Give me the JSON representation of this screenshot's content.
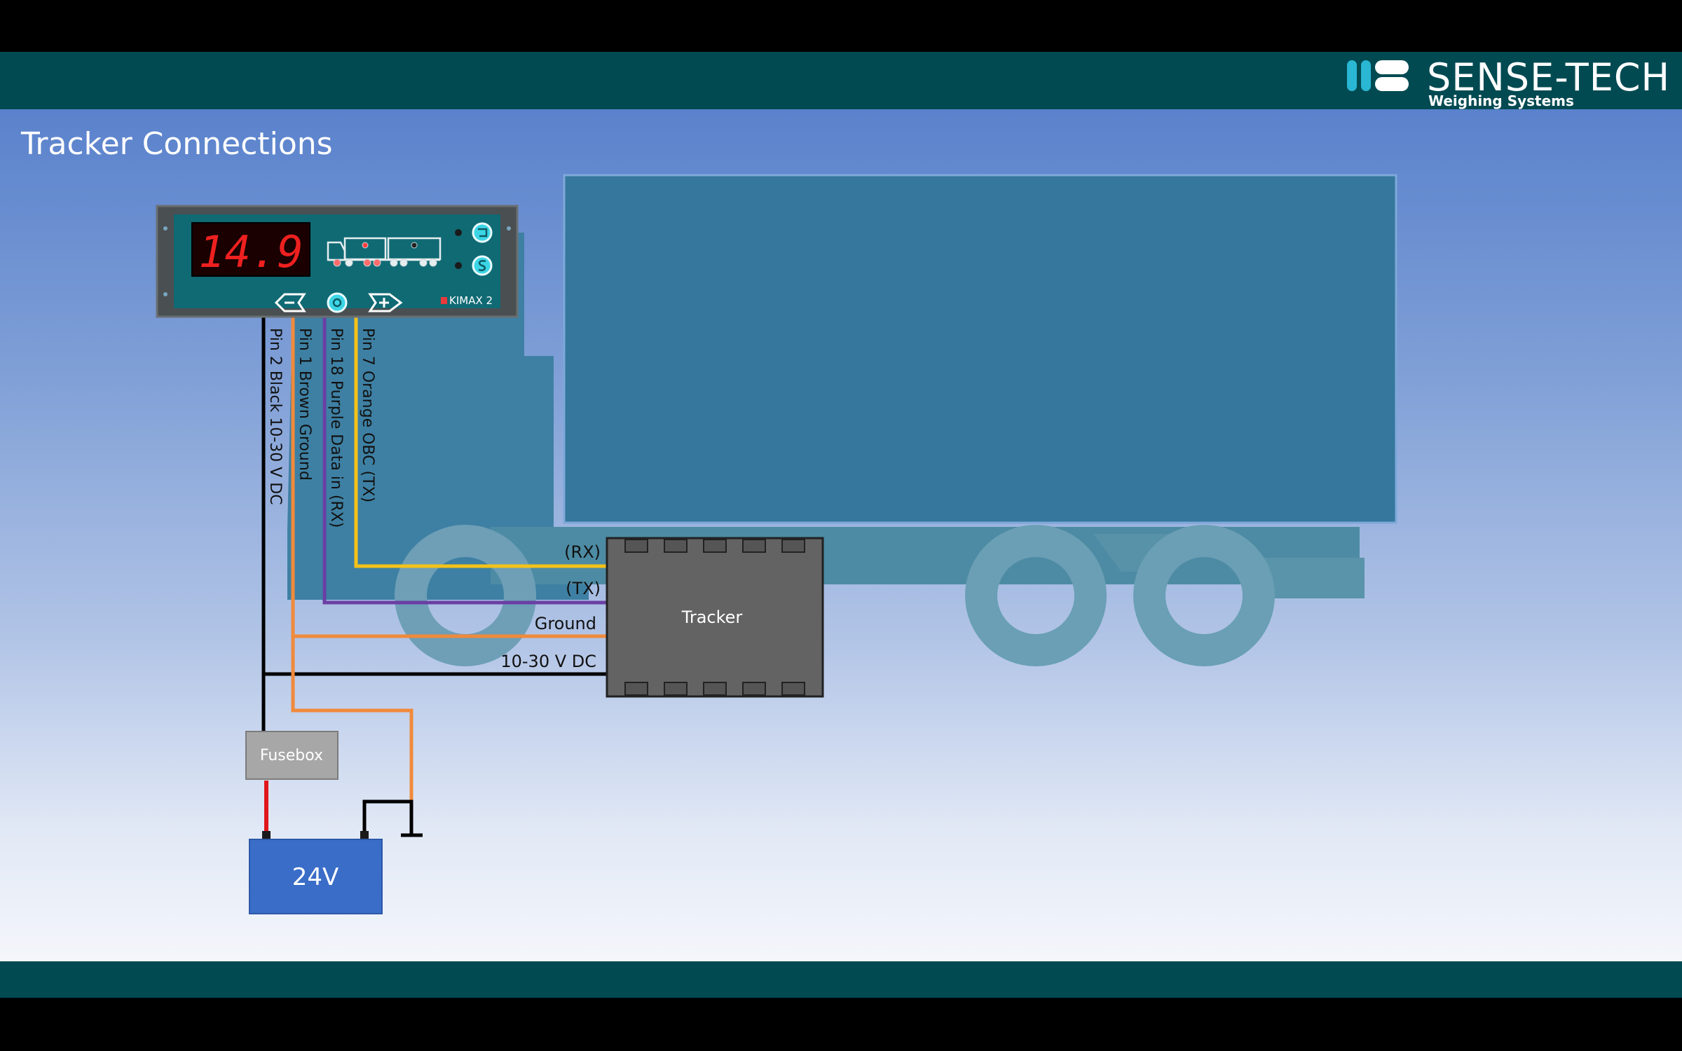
{
  "brand": {
    "name": "SENSE-TECH",
    "tagline": "Weighing Systems",
    "colors": {
      "header": "#024a52",
      "logo_accent": "#29b7d3"
    }
  },
  "page_title": "Tracker Connections",
  "display_unit": {
    "readout": "14.9",
    "model": "KIMAX 2",
    "buttons": [
      "minus-button",
      "ok-button",
      "plus-button"
    ],
    "side_buttons": [
      "tare-button",
      "scale-button"
    ]
  },
  "wires": [
    {
      "label": "Pin 2 Black 10-30 V DC",
      "color": "#000000"
    },
    {
      "label": "Pin 1 Brown Ground",
      "color": "#f08a3c"
    },
    {
      "label": "Pin 18 Purple Data in (RX)",
      "color": "#6b3fa4"
    },
    {
      "label": "Pin 7 Orange OBC (TX)",
      "color": "#f4c218"
    },
    {
      "label": "Battery positive",
      "color": "#e0161b"
    }
  ],
  "tracker": {
    "label": "Tracker",
    "ports": [
      "(RX)",
      "(TX)",
      "Ground",
      "10-30 V DC"
    ]
  },
  "fusebox_label": "Fusebox",
  "battery_label": "24V"
}
